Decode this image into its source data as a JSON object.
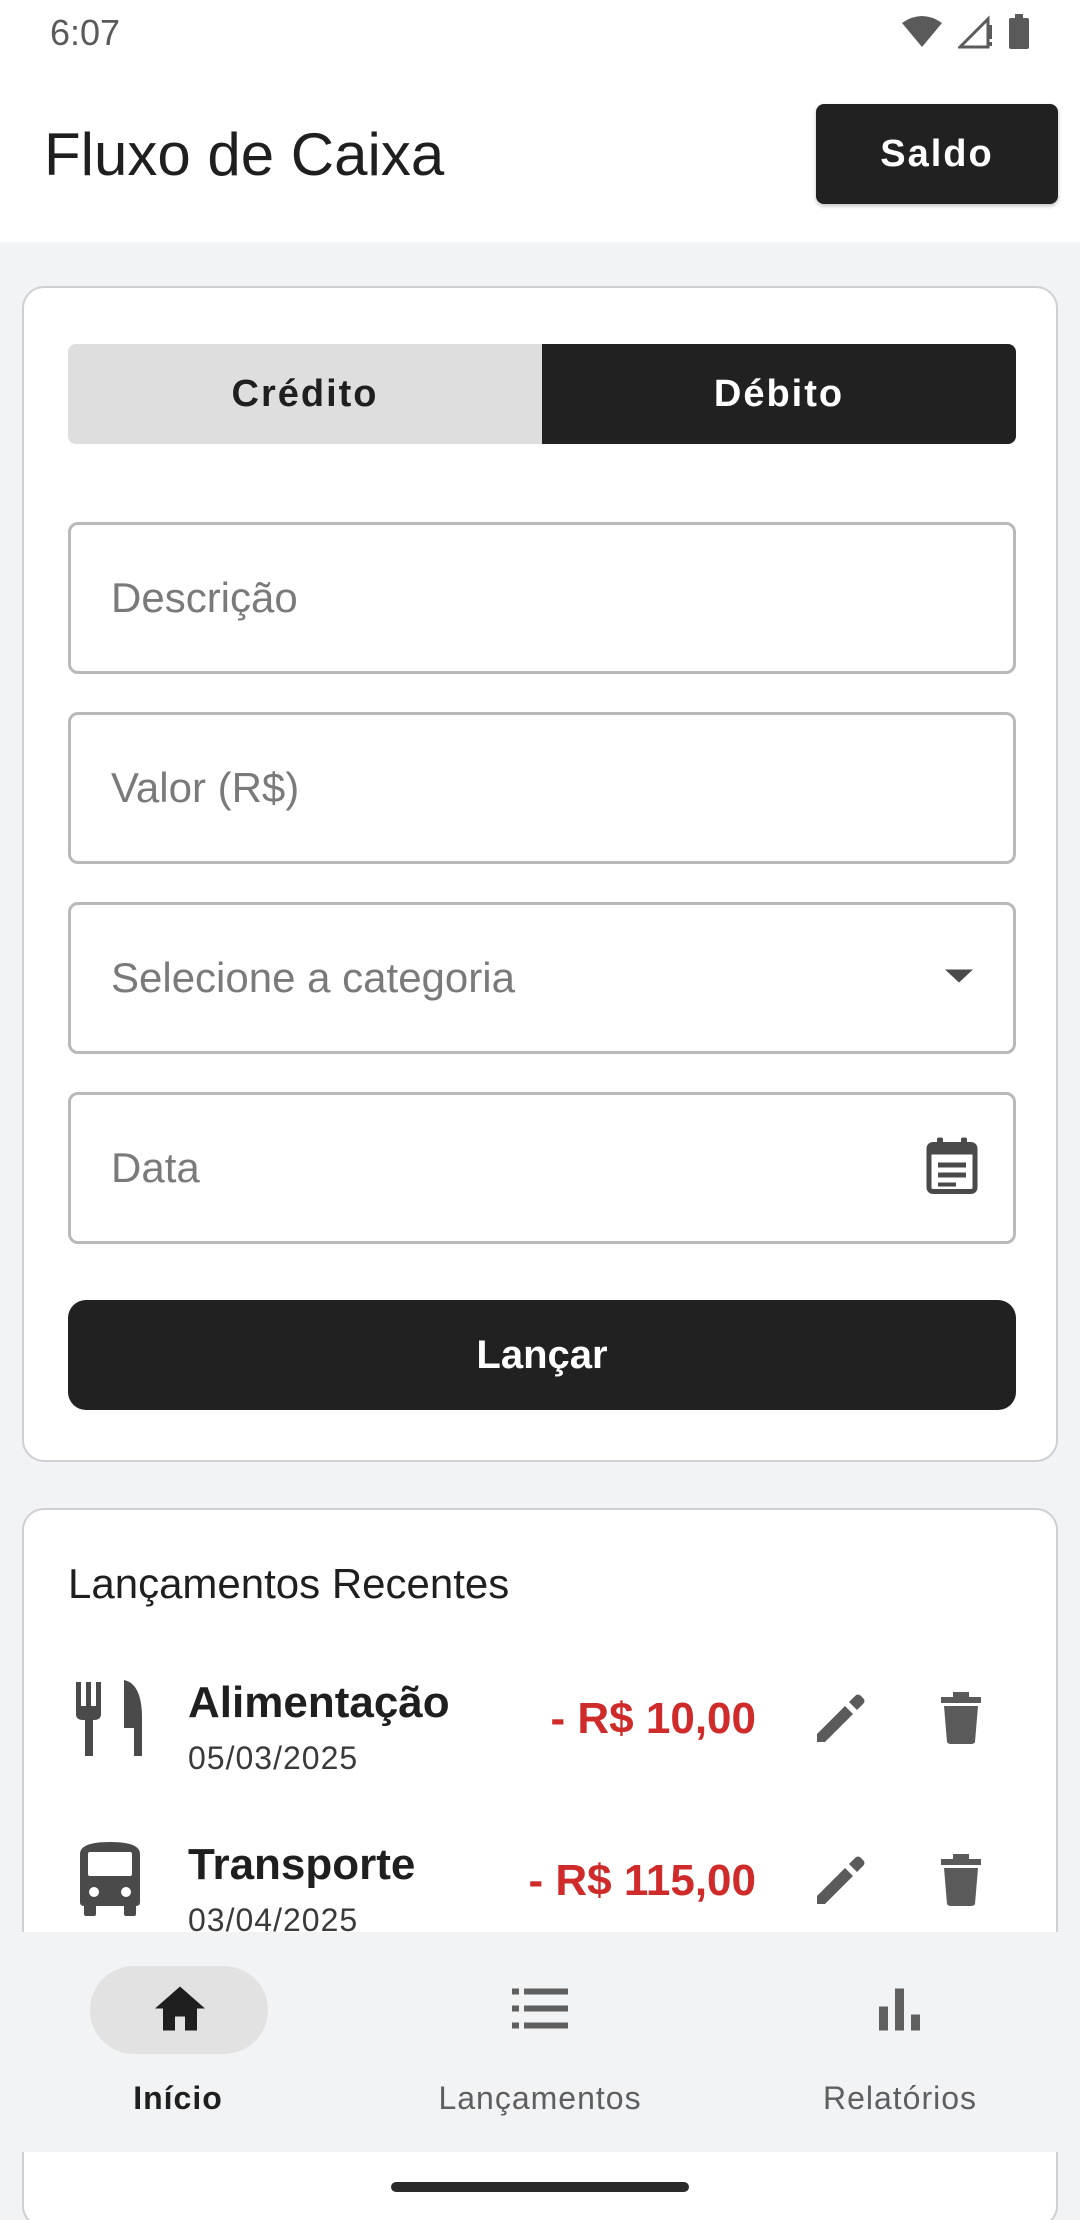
{
  "status_bar": {
    "time": "6:07",
    "icons": [
      "wifi-icon",
      "signal-icon",
      "battery-icon"
    ]
  },
  "app_bar": {
    "title": "Fluxo de Caixa",
    "saldo_label": "Saldo"
  },
  "form": {
    "toggle": {
      "credit_label": "Crédito",
      "debit_label": "Débito",
      "selected": "Débito"
    },
    "description": {
      "placeholder": "Descrição",
      "value": ""
    },
    "value": {
      "placeholder": "Valor (R$)",
      "value": ""
    },
    "category": {
      "placeholder": "Selecione a categoria",
      "icon": "chevron-down-icon"
    },
    "date": {
      "placeholder": "Data",
      "icon": "calendar-icon"
    },
    "submit_label": "Lançar"
  },
  "recent": {
    "title": "Lançamentos Recentes",
    "entries": [
      {
        "category": "Alimentação",
        "date": "05/03/2025",
        "amount": "- R$ 10,00",
        "icon": "restaurant-icon"
      },
      {
        "category": "Transporte",
        "date": "03/04/2025",
        "amount": "- R$ 115,00",
        "icon": "bus-icon"
      }
    ]
  },
  "bottom_nav": {
    "items": [
      {
        "label": "Início",
        "icon": "home-icon",
        "active": true
      },
      {
        "label": "Lançamentos",
        "icon": "list-icon",
        "active": false
      },
      {
        "label": "Relatórios",
        "icon": "bar-chart-icon",
        "active": false
      }
    ]
  },
  "colors": {
    "primary": "#212121",
    "debit_amount": "#cf2b2b",
    "background": "#f2f3f5",
    "card_border": "#cfd0d4"
  }
}
